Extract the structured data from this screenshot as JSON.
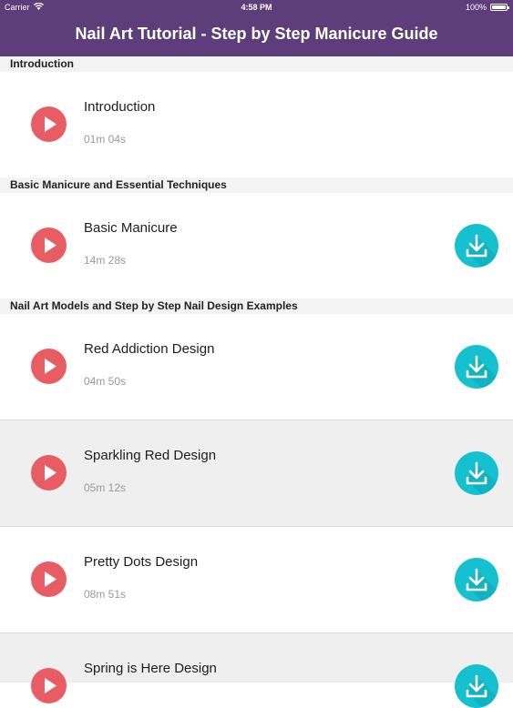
{
  "status_bar": {
    "carrier": "Carrier",
    "time": "4:58 PM",
    "battery": "100%",
    "wifi_icon": "wifi-icon",
    "battery_icon": "battery-icon"
  },
  "header": {
    "title": "Nail Art Tutorial - Step by Step Manicure Guide",
    "color": "#5d3e7a"
  },
  "colors": {
    "play": "#e85d63",
    "download": "#16c1cf",
    "section_bg": "#f3f3f3",
    "alt_row_bg": "#efefef"
  },
  "sections": [
    {
      "title": "Introduction",
      "items": [
        {
          "title": "Introduction",
          "duration": "01m 04s",
          "downloadable": false
        }
      ]
    },
    {
      "title": "Basic Manicure and Essential Techniques",
      "items": [
        {
          "title": "Basic Manicure",
          "duration": "14m 28s",
          "downloadable": true
        }
      ]
    },
    {
      "title": "Nail Art Models and Step by Step Nail Design Examples",
      "items": [
        {
          "title": "Red Addiction Design",
          "duration": "04m 50s",
          "downloadable": true
        },
        {
          "title": "Sparkling Red Design",
          "duration": "05m 12s",
          "downloadable": true
        },
        {
          "title": "Pretty Dots Design",
          "duration": "08m 51s",
          "downloadable": true
        },
        {
          "title": "Spring is Here Design",
          "duration": "",
          "downloadable": true
        }
      ]
    }
  ]
}
